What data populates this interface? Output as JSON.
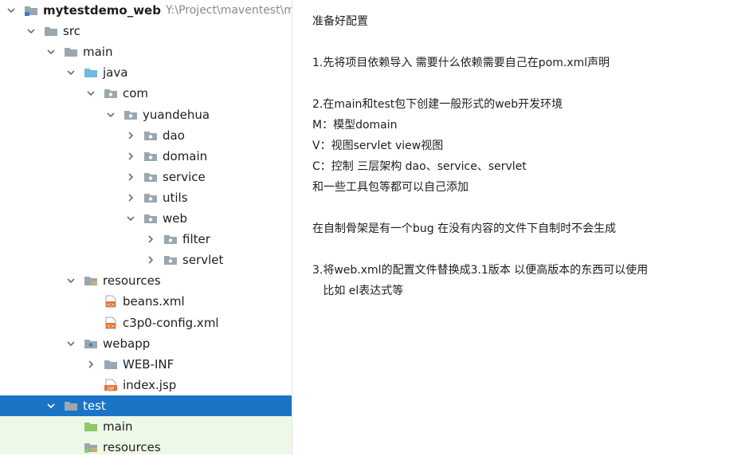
{
  "tree": {
    "rows": [
      {
        "label": "mytestdemo_web",
        "path": "Y:\\Project\\maventest\\m",
        "icon": "module-folder-icon",
        "arrow": "down",
        "depth": 0,
        "is_project": true
      },
      {
        "label": "src",
        "icon": "folder-icon",
        "arrow": "down",
        "depth": 1
      },
      {
        "label": "main",
        "icon": "folder-icon",
        "arrow": "down",
        "depth": 2
      },
      {
        "label": "java",
        "icon": "source-folder-icon",
        "arrow": "down",
        "depth": 3
      },
      {
        "label": "com",
        "icon": "package-icon",
        "arrow": "down",
        "depth": 4
      },
      {
        "label": "yuandehua",
        "icon": "package-icon",
        "arrow": "down",
        "depth": 5
      },
      {
        "label": "dao",
        "icon": "package-icon",
        "arrow": "right",
        "depth": 6
      },
      {
        "label": "domain",
        "icon": "package-icon",
        "arrow": "right",
        "depth": 6
      },
      {
        "label": "service",
        "icon": "package-icon",
        "arrow": "right",
        "depth": 6
      },
      {
        "label": "utils",
        "icon": "package-icon",
        "arrow": "right",
        "depth": 6
      },
      {
        "label": "web",
        "icon": "package-icon",
        "arrow": "down",
        "depth": 6
      },
      {
        "label": "filter",
        "icon": "package-icon",
        "arrow": "right",
        "depth": 7
      },
      {
        "label": "servlet",
        "icon": "package-icon",
        "arrow": "right",
        "depth": 7
      },
      {
        "label": "resources",
        "icon": "resources-folder-icon",
        "arrow": "down",
        "depth": 3
      },
      {
        "label": "beans.xml",
        "icon": "xml-file-icon",
        "arrow": "none",
        "depth": 4
      },
      {
        "label": "c3p0-config.xml",
        "icon": "xml-file-icon",
        "arrow": "none",
        "depth": 4
      },
      {
        "label": "webapp",
        "icon": "web-folder-icon",
        "arrow": "down",
        "depth": 3
      },
      {
        "label": "WEB-INF",
        "icon": "folder-icon",
        "arrow": "right",
        "depth": 4
      },
      {
        "label": "index.jsp",
        "icon": "jsp-file-icon",
        "arrow": "none",
        "depth": 4
      },
      {
        "label": "test",
        "icon": "folder-icon",
        "arrow": "down",
        "depth": 2,
        "selected": true
      },
      {
        "label": "main",
        "icon": "test-folder-icon",
        "arrow": "none",
        "depth": 3,
        "test_scope": true
      },
      {
        "label": "resources",
        "icon": "test-resources-folder-icon",
        "arrow": "none",
        "depth": 3,
        "test_scope": true
      }
    ]
  },
  "notes": {
    "lines": [
      "准备好配置",
      "",
      "1.先将项目依赖导入 需要什么依赖需要自己在pom.xml声明",
      "",
      "2.在main和test包下创建一般形式的web开发环境",
      "M：模型domain",
      "V：视图servlet view视图",
      "C：控制 三层架构 dao、service、servlet",
      "和一些工具包等都可以自己添加",
      "",
      "在自制骨架是有一个bug 在没有内容的文件下自制时不会生成",
      "",
      "3.将web.xml的配置文件替换成3.1版本 以便高版本的东西可以使用",
      "   比如 el表达式等"
    ]
  },
  "colors": {
    "selection": "#1a74c6",
    "test_scope_bg": "#eef8e6",
    "folder": "#9aa7b0",
    "source_folder": "#6fb8e0",
    "test_folder": "#8ec86a",
    "xml": "#e0763a"
  }
}
